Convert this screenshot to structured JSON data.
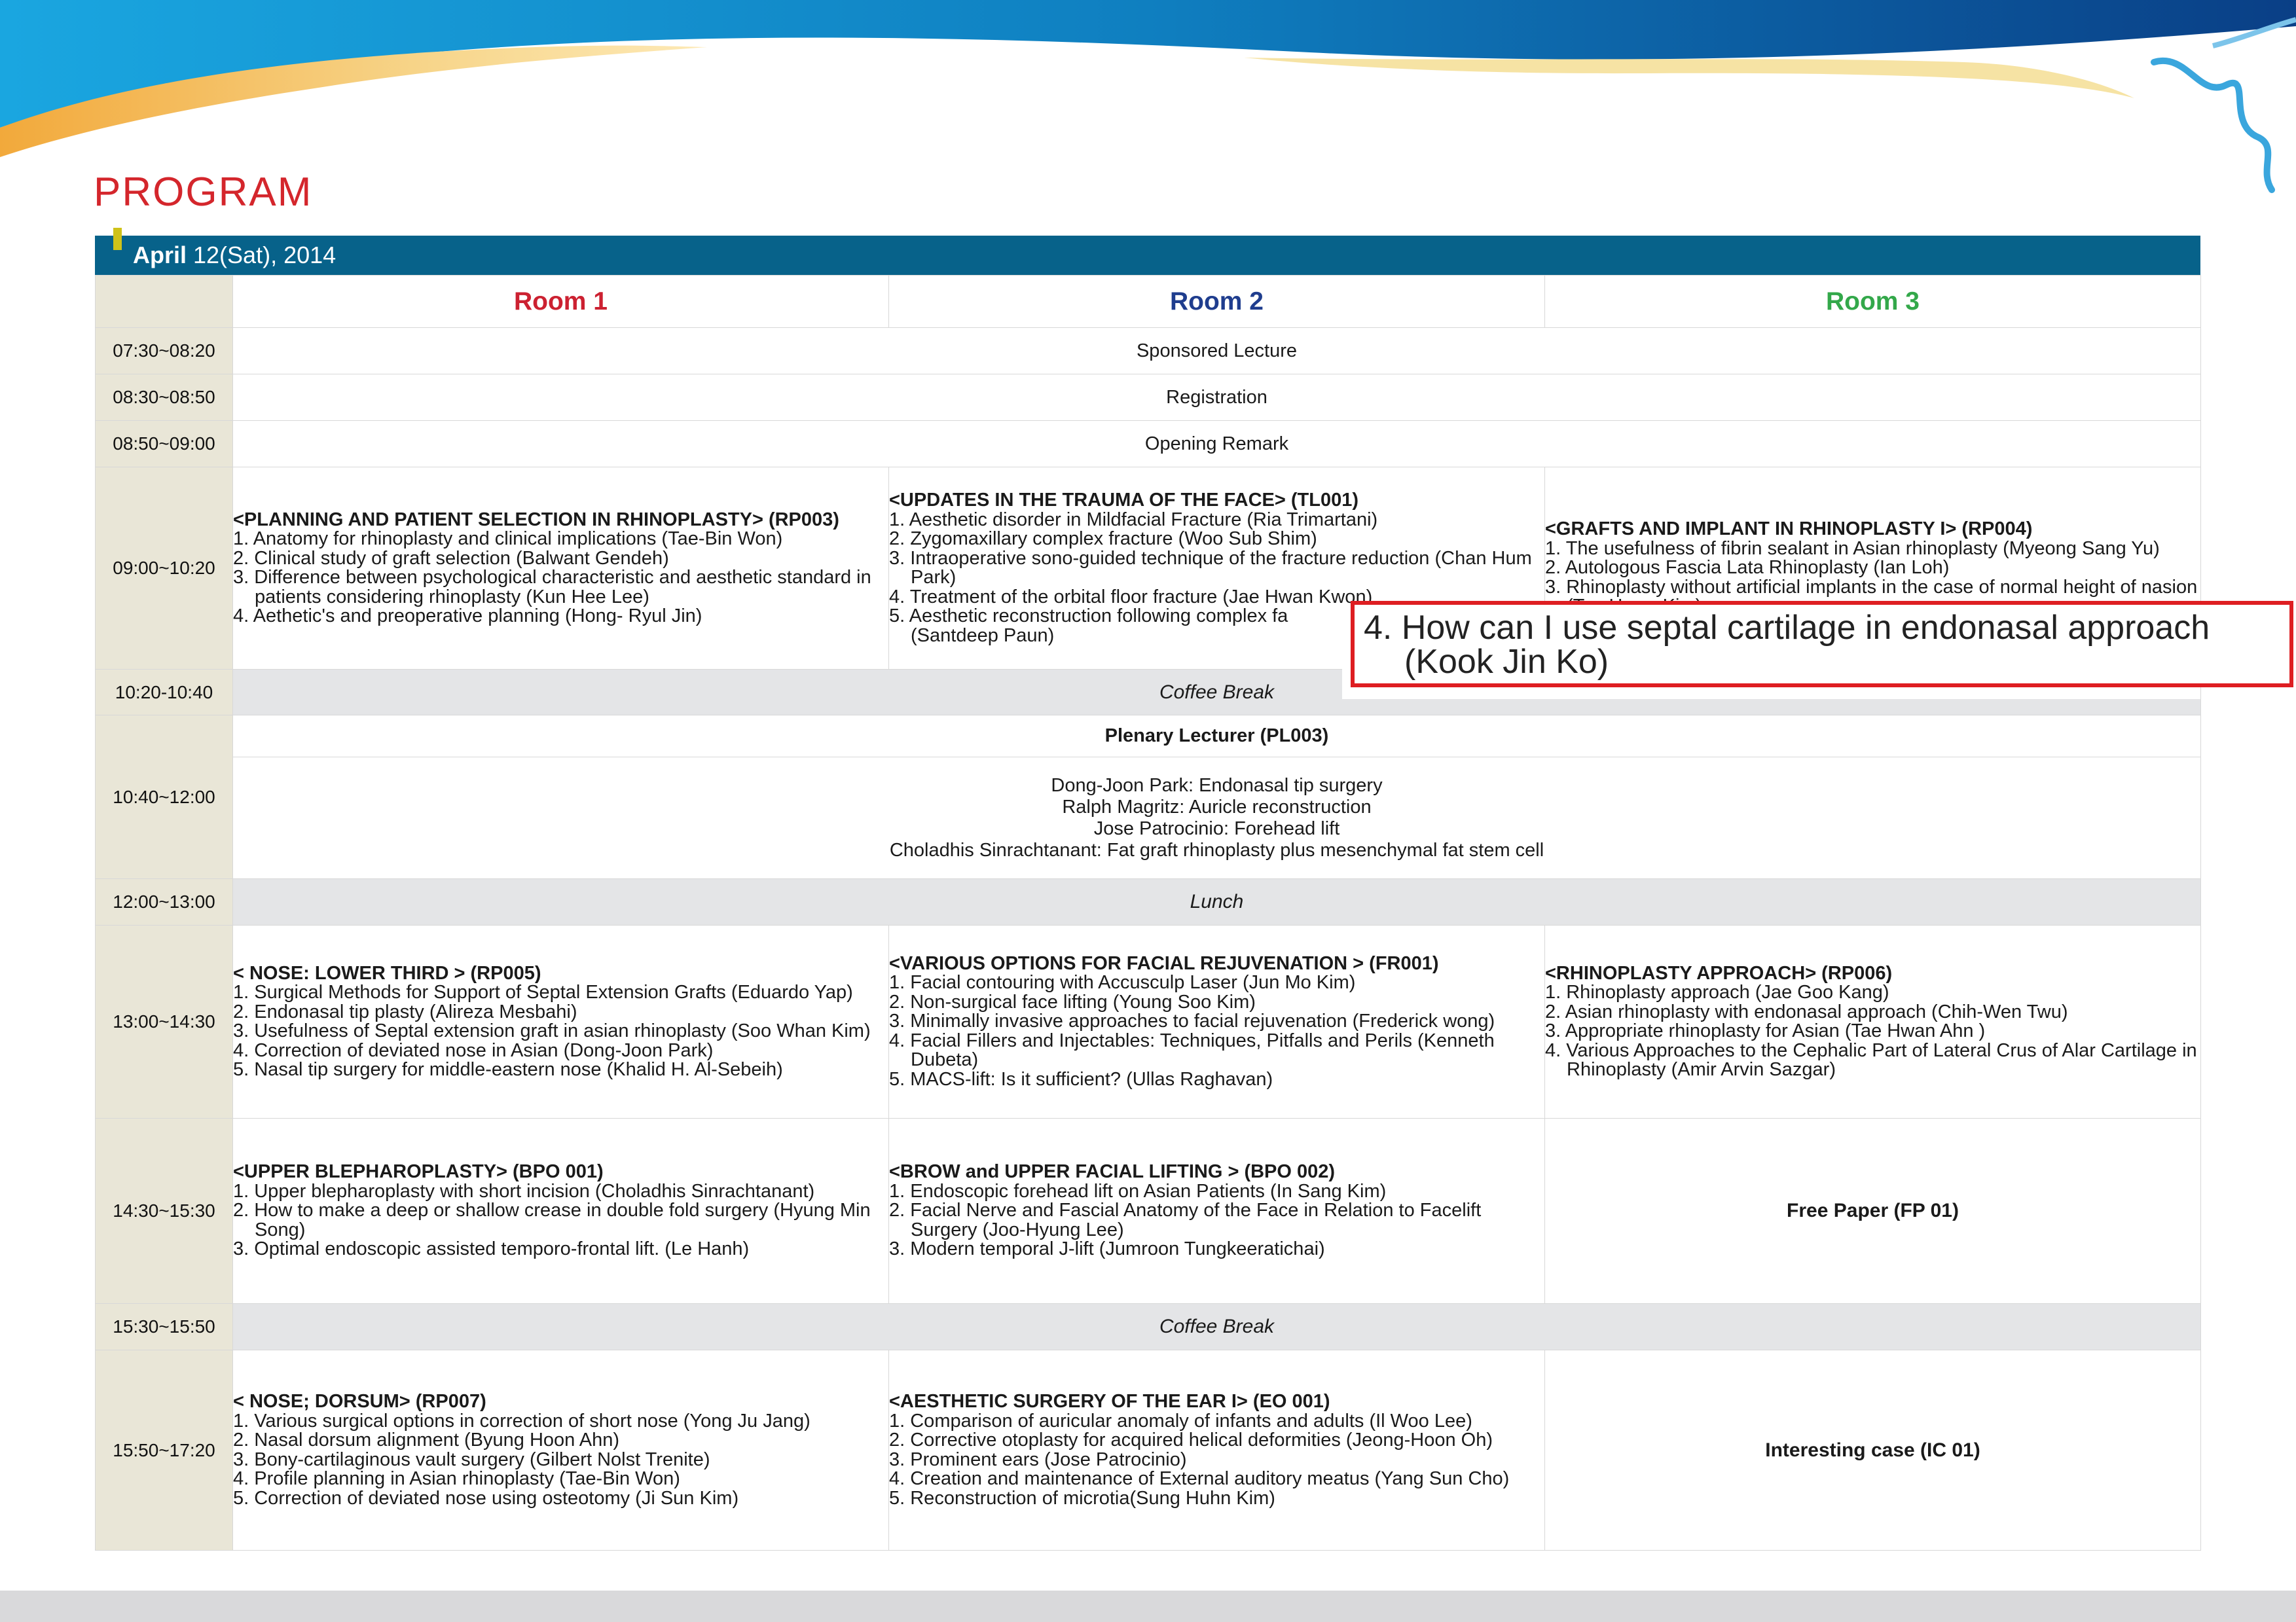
{
  "page_title": "PROGRAM",
  "date": {
    "month": "April",
    "rest": "12(Sat), 2014"
  },
  "rooms": [
    "Room 1",
    "Room 2",
    "Room 3"
  ],
  "rows": {
    "r0730": {
      "time": "07:30~08:20",
      "text": "Sponsored Lecture"
    },
    "r0830": {
      "time": "08:30~08:50",
      "text": "Registration"
    },
    "r0850": {
      "time": "08:50~09:00",
      "text": "Opening Remark"
    },
    "r0900": {
      "time": "09:00~10:20",
      "room1": {
        "title": "<PLANNING AND PATIENT SELECTION IN RHINOPLASTY>  (RP003)",
        "items": [
          "1. Anatomy for rhinoplasty and clinical implications (Tae-Bin Won)",
          "2. Clinical study of graft selection (Balwant Gendeh)",
          "3. Difference between psychological characteristic and aesthetic standard in patients considering rhinoplasty (Kun Hee Lee)",
          "4. Aethetic's and preoperative planning (Hong- Ryul Jin)"
        ]
      },
      "room2": {
        "title": "<UPDATES IN THE TRAUMA OF THE FACE>  (TL001)",
        "items": [
          "1. Aesthetic disorder in Mildfacial Fracture  (Ria Trimartani)",
          "2. Zygomaxillary complex fracture (Woo Sub Shim)",
          "3. Intraoperative sono-guided technique of the fracture reduction (Chan Hum Park)",
          "4. Treatment of the orbital floor fracture (Jae Hwan Kwon)",
          "5. Aesthetic reconstruction following complex fa",
          "(Santdeep Paun)"
        ]
      },
      "room3": {
        "title": "<GRAFTS AND IMPLANT IN RHINOPLASTY I>  (RP004)",
        "items": [
          "1. The usefulness of fibrin sealant in Asian rhinoplasty (Myeong Sang Yu)",
          "2. Autologous Fascia Lata Rhinoplasty (Ian Loh)",
          "3. Rhinoplasty without artificial implants in the case of normal height of nasion (Tae Hwan Kim)"
        ]
      }
    },
    "r1020": {
      "time": "10:20-10:40",
      "text": "Coffee Break"
    },
    "r1040": {
      "time": "10:40~12:00",
      "title": "Plenary Lecturer (PL003)",
      "lines": [
        "Dong-Joon Park: Endonasal tip surgery",
        "Ralph Magritz: Auricle reconstruction",
        "Jose Patrocinio: Forehead lift",
        "Choladhis Sinrachtanant: Fat graft rhinoplasty plus mesenchymal fat stem cell"
      ]
    },
    "r1200": {
      "time": "12:00~13:00",
      "text": "Lunch"
    },
    "r1300": {
      "time": "13:00~14:30",
      "room1": {
        "title": "< NOSE: LOWER THIRD >  (RP005)",
        "items": [
          "1. Surgical Methods for Support of Septal Extension Grafts  (Eduardo Yap)",
          "2. Endonasal tip plasty (Alireza Mesbahi)",
          "3. Usefulness of Septal extension graft in asian rhinoplasty (Soo Whan Kim)",
          "4. Correction of deviated nose in Asian (Dong-Joon Park)",
          "5. Nasal tip surgery for middle-eastern nose (Khalid H. Al-Sebeih)"
        ]
      },
      "room2": {
        "title": "<VARIOUS OPTIONS FOR FACIAL REJUVENATION >  (FR001)",
        "items": [
          "1. Facial contouring with Accusculp Laser (Jun Mo Kim)",
          "2. Non-surgical face lifting (Young Soo Kim)",
          "3. Minimally invasive approaches to facial rejuvenation (Frederick wong)",
          "4. Facial Fillers and Injectables: Techniques, Pitfalls and Perils (Kenneth Dubeta)",
          "5. MACS-lift: Is it sufficient? (Ullas Raghavan)"
        ]
      },
      "room3": {
        "title": "<RHINOPLASTY APPROACH>  (RP006)",
        "items": [
          "1. Rhinoplasty approach (Jae Goo Kang)",
          "2. Asian rhinoplasty with endonasal approach (Chih-Wen Twu)",
          "3. Appropriate rhinoplasty for Asian (Tae Hwan Ahn )",
          "4. Various Approaches to the Cephalic Part of Lateral Crus of Alar Cartilage in Rhinoplasty (Amir Arvin Sazgar)"
        ]
      }
    },
    "r1430": {
      "time": "14:30~15:30",
      "room1": {
        "title": "<UPPER BLEPHAROPLASTY> (BPO 001)",
        "items": [
          "1. Upper blepharoplasty with short incision (Choladhis Sinrachtanant)",
          "2. How to make a deep or shallow crease in double fold surgery (Hyung Min Song)",
          "3. Optimal endoscopic assisted temporo-frontal lift. (Le Hanh)"
        ]
      },
      "room2": {
        "title": "<BROW and UPPER FACIAL LIFTING >   (BPO 002)",
        "items": [
          "1. Endoscopic forehead lift on Asian Patients (In Sang Kim)",
          "2. Facial Nerve and Fascial Anatomy of the Face in Relation to Facelift Surgery (Joo-Hyung Lee)",
          "3. Modern temporal J-lift (Jumroon Tungkeeratichai)"
        ]
      },
      "room3": {
        "text": "Free Paper (FP 01)"
      }
    },
    "r1530": {
      "time": "15:30~15:50",
      "text": "Coffee Break"
    },
    "r1550": {
      "time": "15:50~17:20",
      "room1": {
        "title": "< NOSE; DORSUM>  (RP007)",
        "items": [
          "1. Various surgical options in correction of short nose (Yong Ju Jang)",
          "2. Nasal dorsum alignment (Byung Hoon Ahn)",
          "3. Bony-cartilaginous vault surgery (Gilbert Nolst  Trenite)",
          "4. Profile planning in Asian rhinoplasty (Tae-Bin Won)",
          "5. Correction of deviated nose using osteotomy (Ji Sun Kim)"
        ]
      },
      "room2": {
        "title": "<AESTHETIC SURGERY OF THE EAR I>  (EO 001)",
        "items": [
          "1. Comparison of auricular anomaly of infants and adults (Il Woo Lee)",
          "2. Corrective otoplasty for acquired helical deformities (Jeong-Hoon Oh)",
          "3. Prominent ears (Jose Patrocinio)",
          "4. Creation and maintenance of External auditory meatus (Yang Sun Cho)",
          "5. Reconstruction of microtia(Sung Huhn Kim)"
        ]
      },
      "room3": {
        "text": "Interesting case  (IC 01)"
      }
    }
  },
  "overlay": {
    "line1": "4. How can I use septal cartilage in endonasal approach",
    "line2": "(Kook Jin Ko)"
  },
  "colors": {
    "title_red": "#d4262c",
    "date_bar": "#07628a",
    "room1": "#cc2131",
    "room2": "#1f3d8e",
    "room3": "#33a84a",
    "time_col": "#e9e6d7",
    "break_row": "#e4e5e7",
    "highlight_border": "#de1e22"
  }
}
